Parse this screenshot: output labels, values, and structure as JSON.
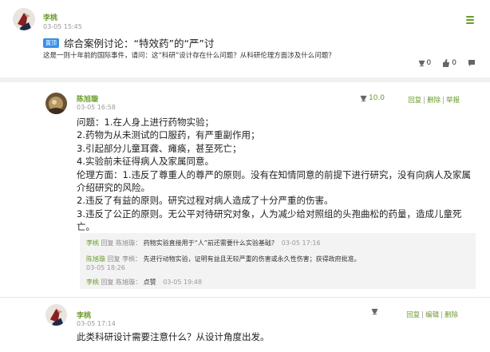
{
  "post": {
    "author": "李桃",
    "time": "03-05 15:45",
    "pin_label": "置顶",
    "title": "综合案例讨论：“特效药”的“严”讨",
    "description": "这是一则十年前的国际事件，请问：这“科研”设计存在什么问题？从科研伦理方面涉及什么问题？",
    "score": "0",
    "likes": "0",
    "actions": {
      "like_icon": "thumbs-up-icon",
      "score_icon": "trophy-icon",
      "comment_icon": "comment-icon"
    }
  },
  "reply1": {
    "author": "陈旭璇",
    "time": "03-05 16:58",
    "score": "10.0",
    "ops": {
      "reply": "回复",
      "delete": "删除",
      "report": "举报"
    },
    "lines": [
      "问题：1.在人身上进行药物实验；",
      "2.药物为从未测试的口服药，有严重副作用；",
      "3.引起部分儿童耳聋、瘫痪，甚至死亡；",
      "4.实验前未征得病人及家属同意。",
      "伦理方面：1.违反了尊重人的尊严的原则。没有在知情同意的前提下进行研究，没有向病人及家属",
      "介绍研究的风险。",
      "2.违反了有益的原则。研究过程对病人造成了十分严重的伤害。",
      "3.违反了公正的原则。无公平对待研究对象，人为减少给对照组的头孢曲松的药量，造成儿童死",
      "亡。"
    ],
    "subs": [
      {
        "from": "李桃",
        "verb": "回复",
        "to": "陈旭璇：",
        "text": "药物实验直接用于“人”前还需要什么实验基础?",
        "time": "03-05 17:16"
      },
      {
        "from": "陈旭璇",
        "verb": "回复",
        "to": "李桃：",
        "text": "先进行动物实验，证明有益且无较严重的伤害或永久性伤害；获得政府批准。",
        "time": "03-05 18:26"
      },
      {
        "from": "李桃",
        "verb": "回复",
        "to": "陈旭璇：",
        "text": "点赞",
        "time": "03-05 19:48"
      }
    ]
  },
  "reply2": {
    "author": "李桃",
    "time": "03-05 17:14",
    "ops": {
      "reply": "回复",
      "edit": "编辑",
      "delete": "删除"
    },
    "content": "此类科研设计需要注意什么？从设计角度出发。"
  },
  "colors": {
    "accent_green": "#6b9c2c",
    "pin_blue": "#3a8ee6"
  }
}
